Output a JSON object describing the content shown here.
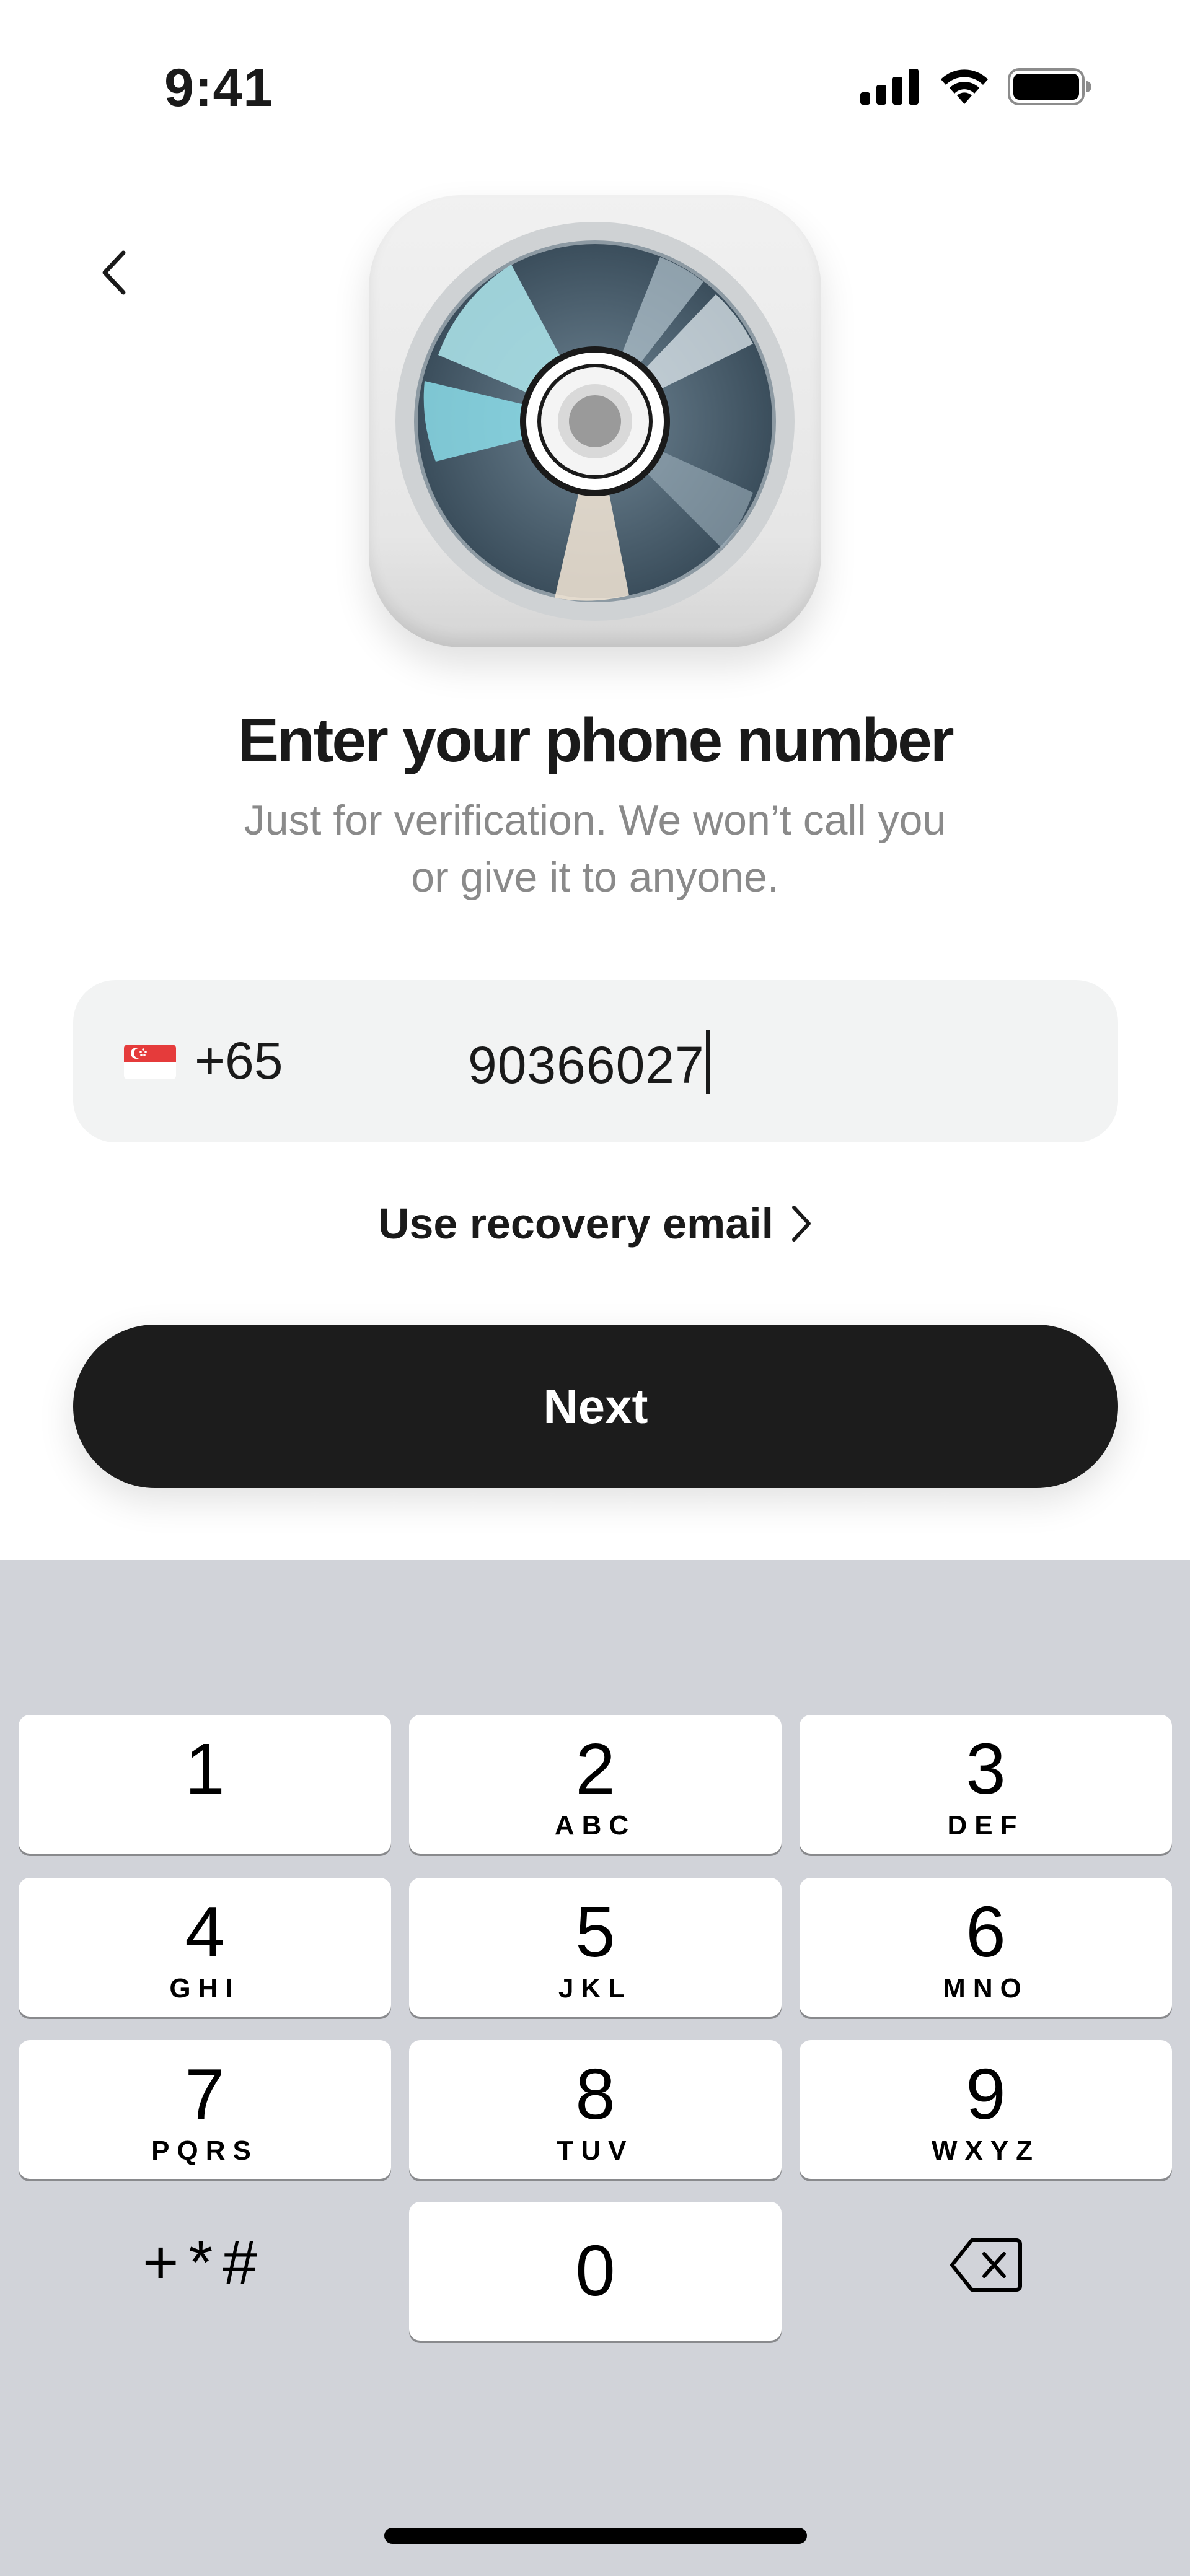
{
  "status_bar": {
    "time": "9:41",
    "icons": [
      "signal-icon",
      "wifi-icon",
      "battery-icon"
    ]
  },
  "header": {
    "back_icon": "chevron-left-icon"
  },
  "app_icon": {
    "name": "cd-disc-icon"
  },
  "title": "Enter your phone number",
  "subtitle": "Just for verification. We won’t call you or give it to anyone.",
  "phone_input": {
    "country_flag": "singapore-flag-icon",
    "country_code": "+65",
    "value": "90366027"
  },
  "recovery_link": {
    "label": "Use recovery email",
    "icon": "chevron-right-icon"
  },
  "next_button": {
    "label": "Next"
  },
  "keypad": {
    "keys": [
      {
        "digit": "1",
        "letters": ""
      },
      {
        "digit": "2",
        "letters": "ABC"
      },
      {
        "digit": "3",
        "letters": "DEF"
      },
      {
        "digit": "4",
        "letters": "GHI"
      },
      {
        "digit": "5",
        "letters": "JKL"
      },
      {
        "digit": "6",
        "letters": "MNO"
      },
      {
        "digit": "7",
        "letters": "PQRS"
      },
      {
        "digit": "8",
        "letters": "TUV"
      },
      {
        "digit": "9",
        "letters": "WXYZ"
      },
      {
        "digit": "0",
        "letters": ""
      }
    ],
    "symbols_label": "+*#",
    "delete_icon": "backspace-icon"
  },
  "colors": {
    "button": "#1c1c1c",
    "field_bg": "#f2f3f3",
    "keypad_bg": "#d1d3d9",
    "subtitle": "#8a8a8a"
  }
}
